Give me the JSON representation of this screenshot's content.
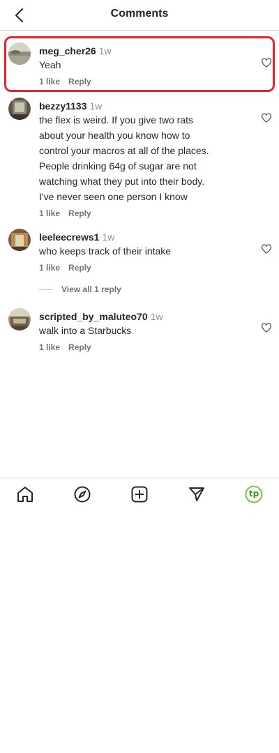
{
  "header": {
    "title": "Comments"
  },
  "comments": [
    {
      "user": "meg_cher26",
      "time": "1w",
      "text": "Yeah",
      "likes": "1 like",
      "reply": "Reply"
    },
    {
      "user": "bezzy1133",
      "time": "1w",
      "lines": [
        "the flex is weird. If you give two rats",
        "about your health you know how to",
        "control your macros at all of the places.",
        "People drinking 64g of sugar are not",
        "watching what they put into their body.",
        "I've never seen one person I know"
      ],
      "likes": "1 like",
      "reply": "Reply"
    },
    {
      "user": "leeleecrews1",
      "time": "1w",
      "text": "who keeps track of their intake",
      "likes": "1 like",
      "reply": "Reply",
      "view_replies": "View all 1 reply"
    },
    {
      "user": "scripted_by_maluteo70",
      "time": "1w",
      "text": "walk into a Starbucks",
      "likes": "1 like",
      "reply": "Reply"
    }
  ],
  "tabbar": {
    "icons": [
      "home-icon",
      "explore-compass-icon",
      "create-plus-icon",
      "direct-send-icon",
      "profile-icon"
    ],
    "profile_badge": "tp",
    "accent": "#7cc242"
  },
  "highlight_color": "#e0262e"
}
